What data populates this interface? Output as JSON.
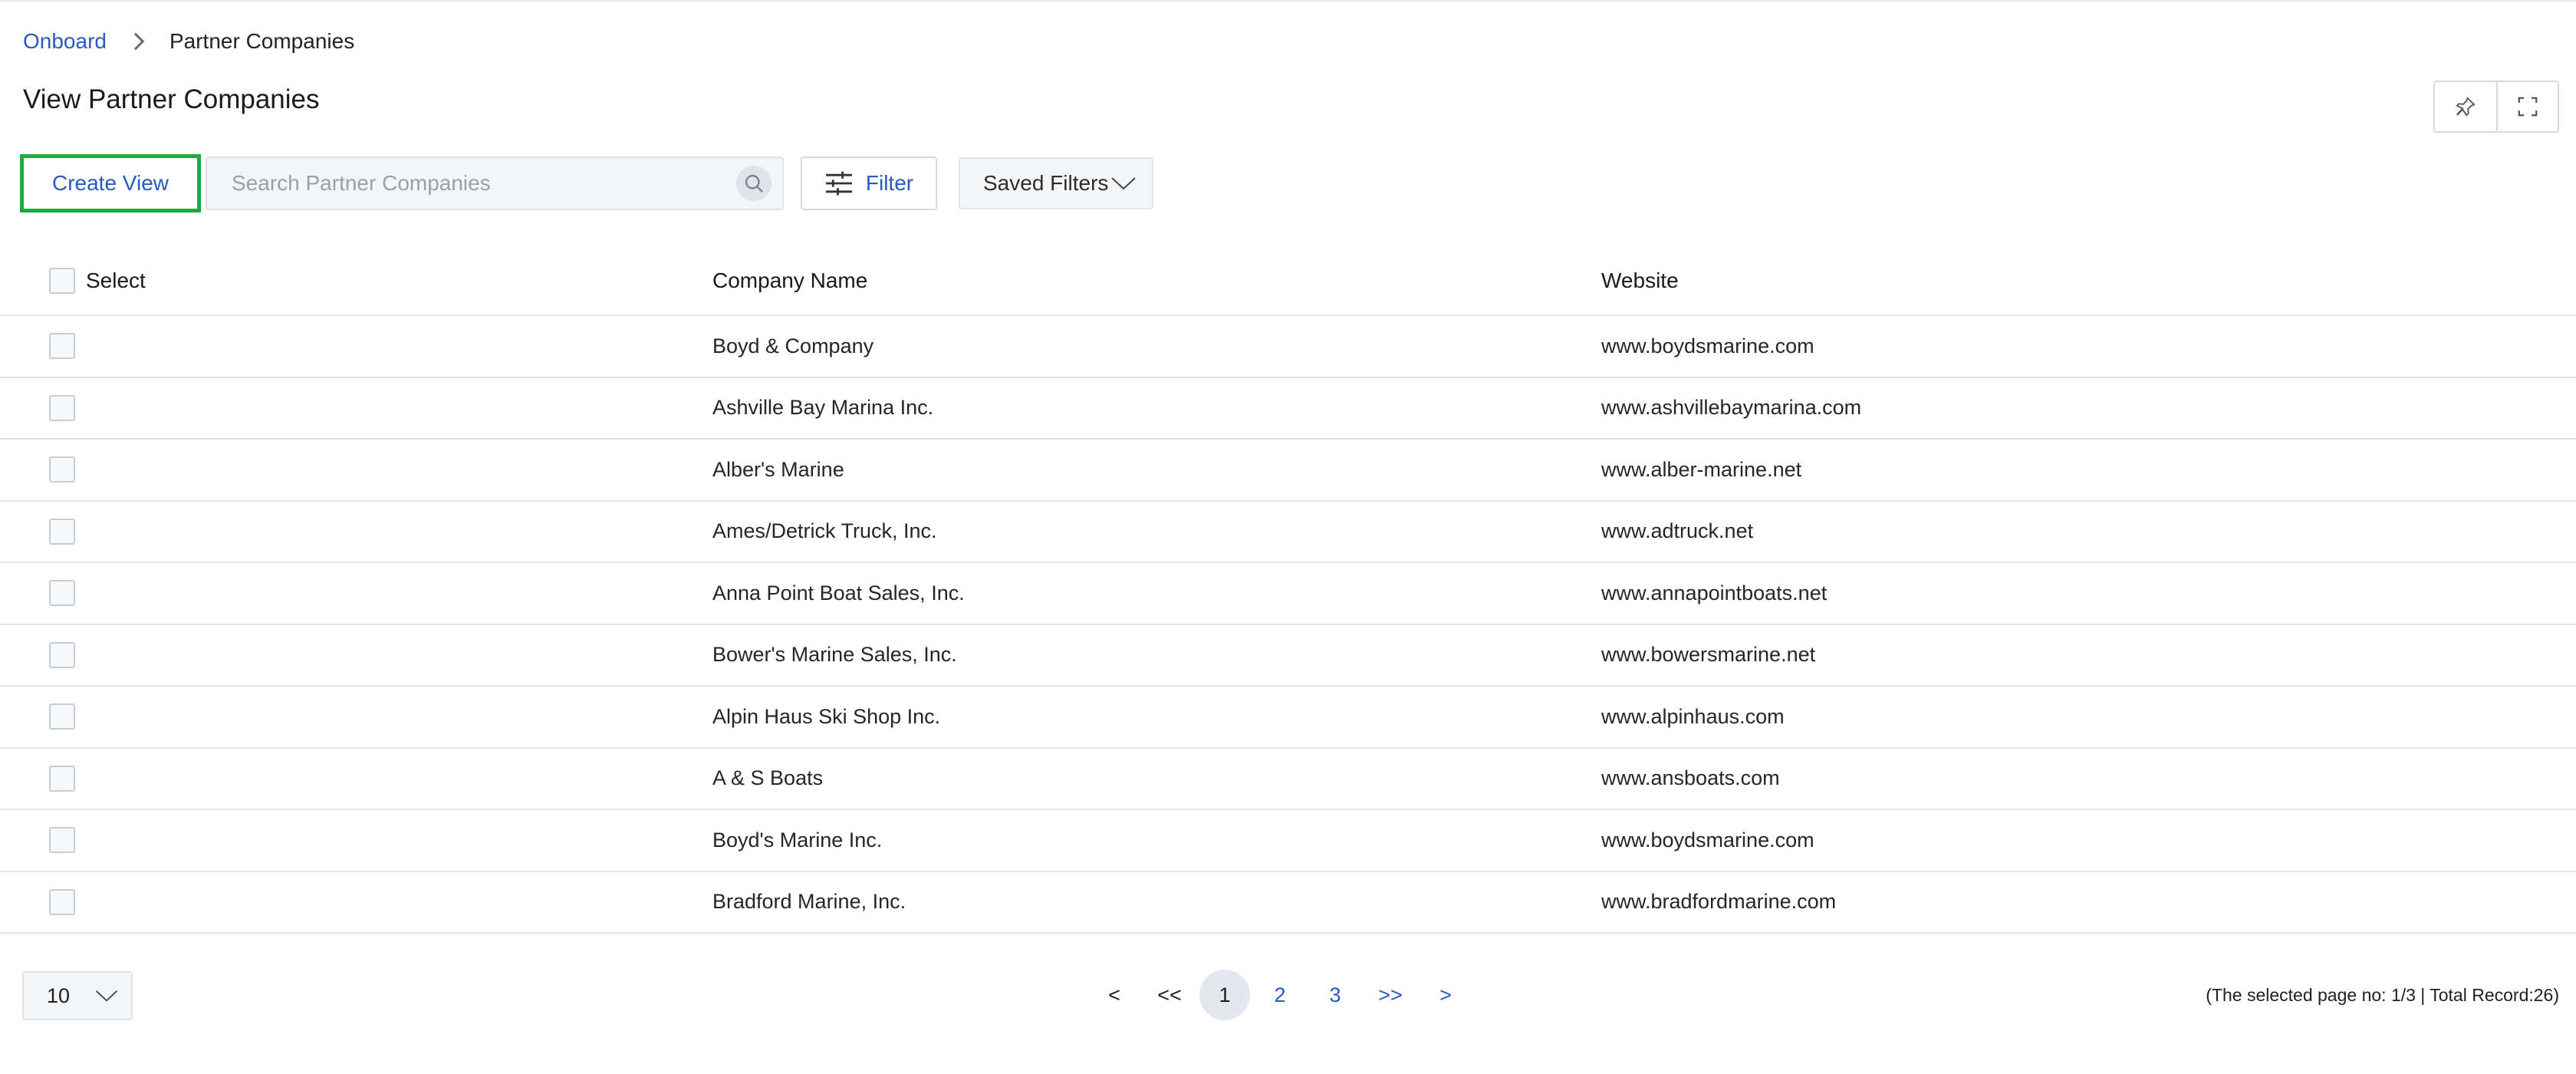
{
  "breadcrumb": {
    "root": "Onboard",
    "current": "Partner Companies"
  },
  "page": {
    "title": "View Partner Companies"
  },
  "toolbar": {
    "create_view_label": "Create View",
    "search_placeholder": "Search Partner Companies",
    "filter_label": "Filter",
    "saved_filters_label": "Saved Filters"
  },
  "table": {
    "headers": {
      "select": "Select",
      "company": "Company Name",
      "website": "Website"
    },
    "rows": [
      {
        "company": "Boyd & Company",
        "website": "www.boydsmarine.com"
      },
      {
        "company": "Ashville Bay Marina Inc.",
        "website": "www.ashvillebaymarina.com"
      },
      {
        "company": "Alber's Marine",
        "website": "www.alber-marine.net"
      },
      {
        "company": "Ames/Detrick Truck, Inc.",
        "website": "www.adtruck.net"
      },
      {
        "company": "Anna Point Boat Sales, Inc.",
        "website": "www.annapointboats.net"
      },
      {
        "company": "Bower's Marine Sales, Inc.",
        "website": "www.bowersmarine.net"
      },
      {
        "company": "Alpin Haus Ski Shop Inc.",
        "website": "www.alpinhaus.com"
      },
      {
        "company": "A & S Boats",
        "website": "www.ansboats.com"
      },
      {
        "company": "Boyd's Marine Inc.",
        "website": "www.boydsmarine.com"
      },
      {
        "company": "Bradford Marine, Inc.",
        "website": "www.bradfordmarine.com"
      }
    ]
  },
  "pagination": {
    "page_size": "10",
    "prev": "<",
    "first": "<<",
    "pages": [
      "1",
      "2",
      "3"
    ],
    "active_page": "1",
    "last": ">>",
    "next": ">",
    "status": "(The selected page no: 1/3 | Total Record:26)"
  },
  "colors": {
    "link": "#2a59c4",
    "highlight_border": "#1faa3f"
  }
}
